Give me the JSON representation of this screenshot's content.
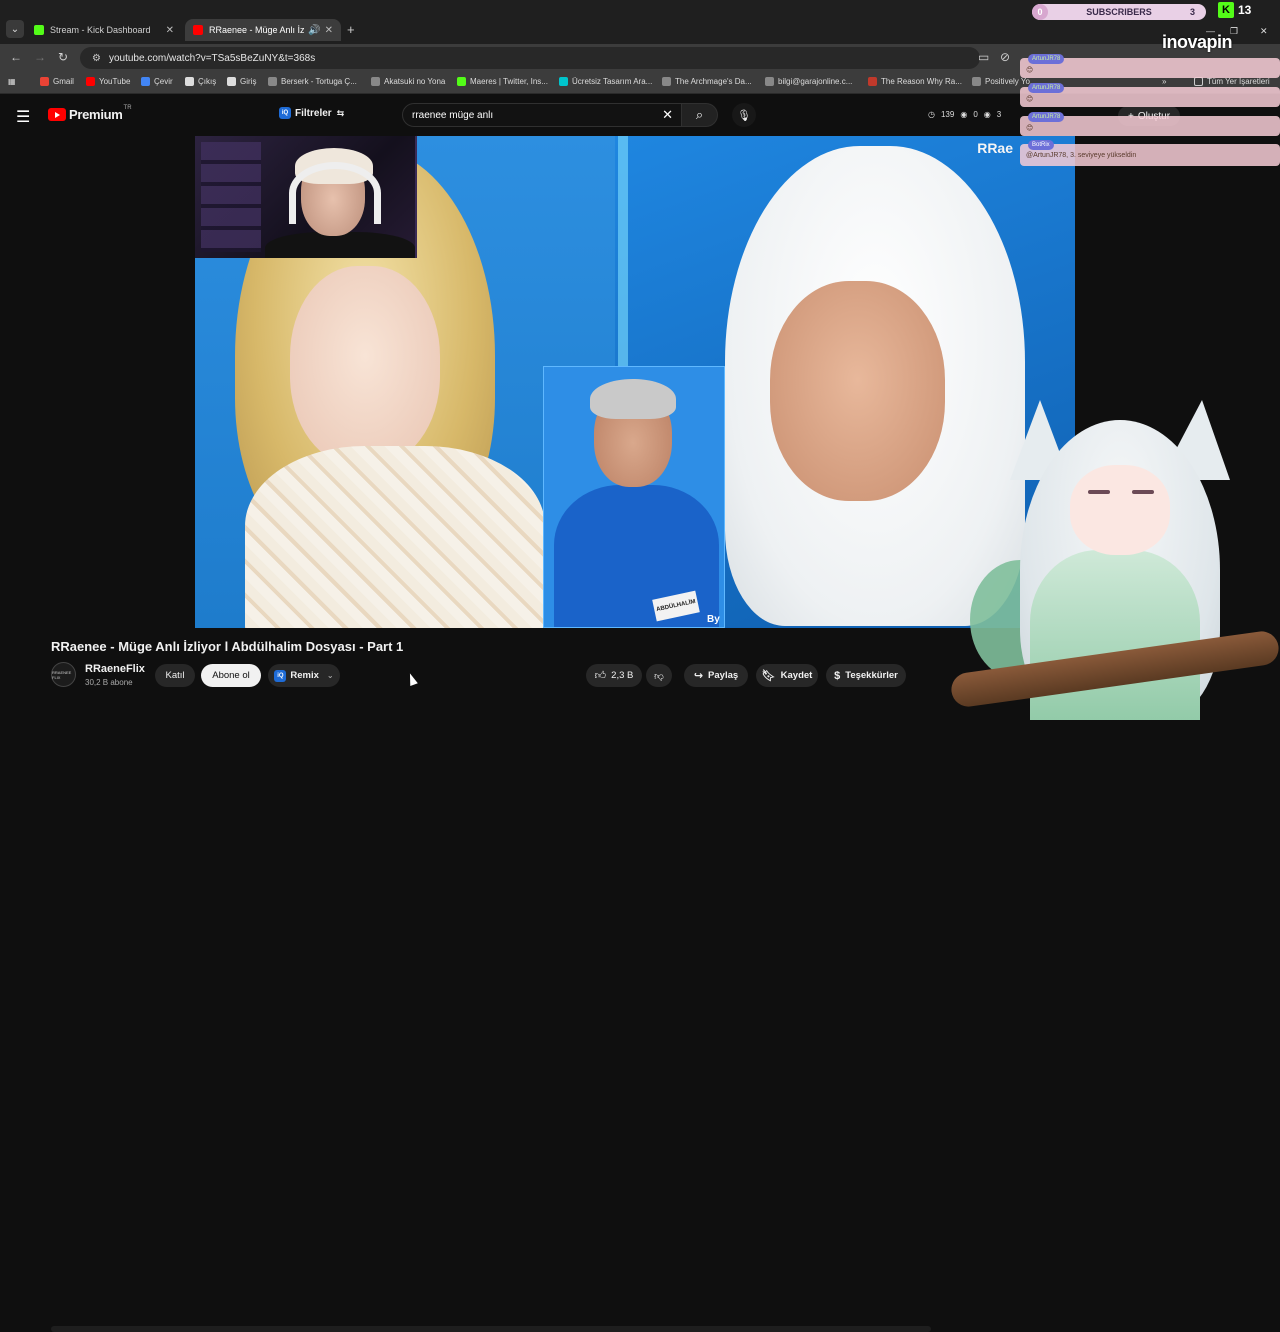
{
  "browser": {
    "tabs": [
      {
        "label": "Stream - Kick Dashboard",
        "fav_color": "#53fc18"
      },
      {
        "label": "RRaenee - Müge Anlı İzliyor",
        "fav_color": "#ff0000"
      }
    ],
    "url": "youtube.com/watch?v=TSa5sBeZuNY&t=368s",
    "bookmarks": [
      {
        "label": "Gmail",
        "color": "#ea4335"
      },
      {
        "label": "YouTube",
        "color": "#ff0000"
      },
      {
        "label": "Çevir",
        "color": "#4285f4"
      },
      {
        "label": "Çıkış",
        "color": "#dddddd"
      },
      {
        "label": "Giriş",
        "color": "#dddddd"
      },
      {
        "label": "Berserk - Tortuga Ç...",
        "color": "#888888"
      },
      {
        "label": "Akatsuki no Yona",
        "color": "#888888"
      },
      {
        "label": "Maeres | Twitter, Ins...",
        "color": "#53fc18"
      },
      {
        "label": "Ücretsiz Tasarım Ara...",
        "color": "#00c4cc"
      },
      {
        "label": "The Archmage's Da...",
        "color": "#888888"
      },
      {
        "label": "bilgi@garajonline.c...",
        "color": "#888888"
      },
      {
        "label": "The Reason Why Ra...",
        "color": "#c0392b"
      },
      {
        "label": "Positively Yo...",
        "color": "#888888"
      }
    ],
    "all_bookmarks": "Tüm Yer İşaretleri"
  },
  "youtube": {
    "logo_word": "Premium",
    "logo_region": "TR",
    "filters_label": "Filtreler",
    "search_value": "rraenee müge anlı",
    "stats": {
      "s1": "139",
      "s2": "0",
      "s3": "3"
    },
    "create_label": "Oluştur"
  },
  "video": {
    "watermark": "RRae",
    "watermark_bottom": "By",
    "name_tag": "ABDÜLHALİM",
    "title": "RRaenee - Müge Anlı İzliyor l Abdülhalim Dosyası - Part 1"
  },
  "channel": {
    "avatar_text": "RRAENEE FLIX",
    "name": "RRaeneFlix",
    "subs": "30,2 B abone",
    "join_label": "Katıl",
    "subscribe_label": "Abone ol",
    "remix_label": "Remix"
  },
  "actions": {
    "likes": "2,3 B",
    "share": "Paylaş",
    "save": "Kaydet",
    "thanks": "Teşekkürler"
  },
  "overlay": {
    "subs_left": "0",
    "subs_label": "SUBSCRIBERS",
    "subs_right": "3",
    "kick_count": "13",
    "brand": "inovapin",
    "chat": [
      {
        "user": "ArtunJR78",
        "msg": ""
      },
      {
        "user": "ArtunJR78",
        "msg": ""
      },
      {
        "user": "ArtunJR78",
        "msg": ""
      },
      {
        "user": "BotRix",
        "msg": "@ArtunJR78, 3. seviyeye yükseldin"
      }
    ]
  }
}
